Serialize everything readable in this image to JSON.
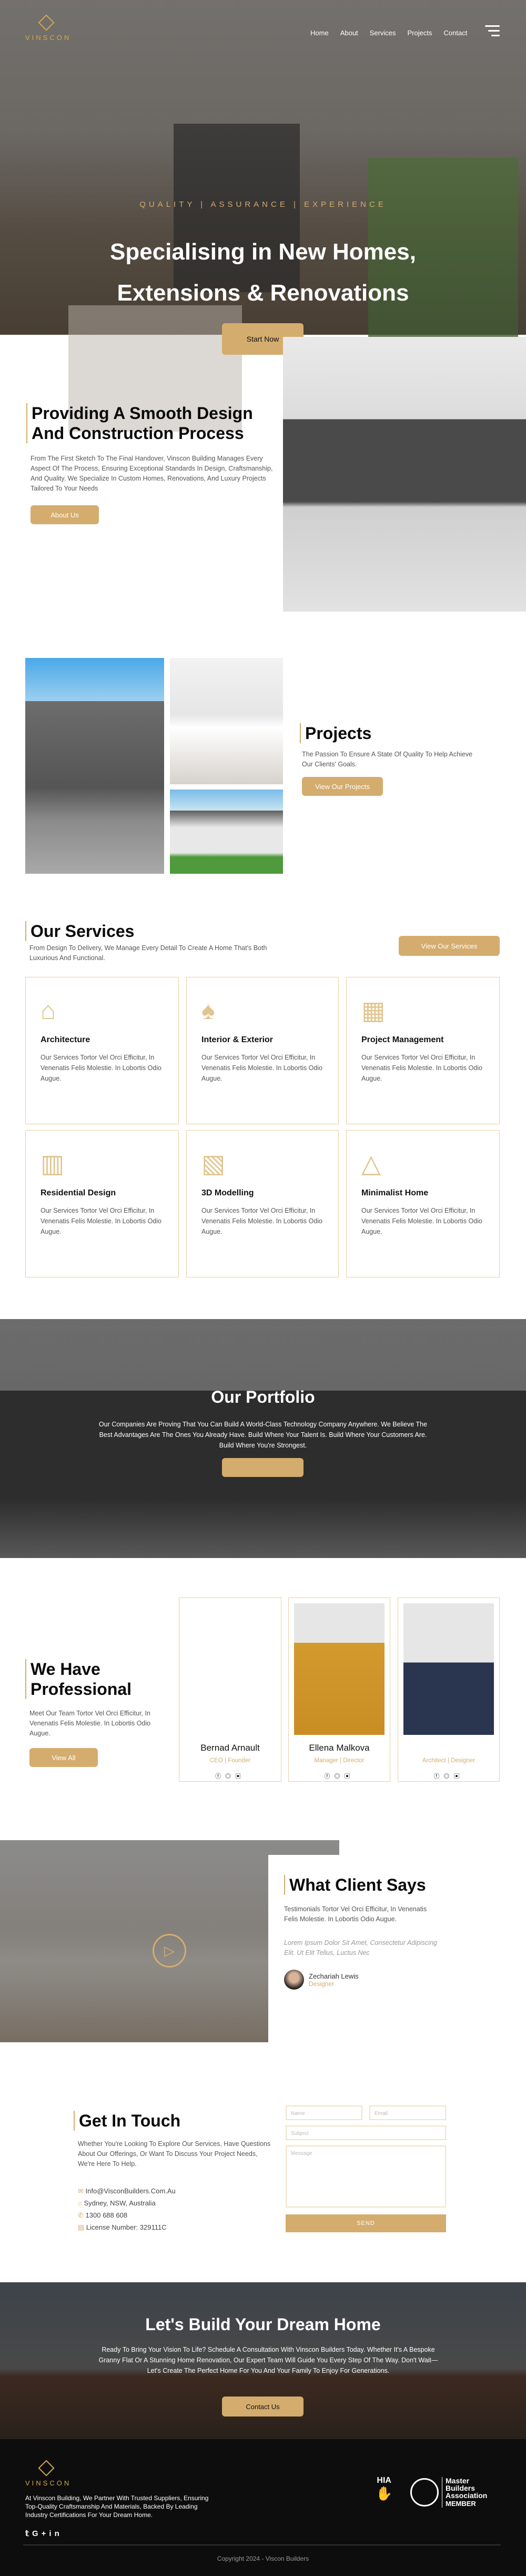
{
  "brand": {
    "name": "VINSCON"
  },
  "nav": {
    "items": [
      "Home",
      "About",
      "Services",
      "Projects",
      "Contact"
    ]
  },
  "hero": {
    "tagline": "QUALITY | ASSURANCE | EXPERIENCE",
    "title_line1": "Specialising in New Homes,",
    "title_line2": "Extensions & Renovations",
    "cta": "Start Now"
  },
  "about": {
    "title": "Providing A Smooth Design And Construction Process",
    "body": "From The First Sketch To The Final Handover, Vinscon Building Manages Every Aspect Of The Process, Ensuring Exceptional Standards In Design, Craftsmanship, And Quality. We Specialize In Custom Homes, Renovations, And Luxury Projects Tailored To Your Needs",
    "cta": "About Us"
  },
  "projects": {
    "title": "Projects",
    "body": "The Passion To Ensure A State Of Quality To Help Achieve Our Clients' Goals.",
    "cta": "View Our Projects"
  },
  "services": {
    "title": "Our Services",
    "body": "From Design To Delivery, We Manage Every Detail To Create A Home That's Both Luxurious And Functional.",
    "cta": "View Our Services",
    "items": [
      {
        "title": "Architecture",
        "body": "Our Services Tortor Vel Orci Efficitur, In Venenatis Felis Molestie. In Lobortis Odio Augue.",
        "icon": "house-outline-icon"
      },
      {
        "title": "Interior & Exterior",
        "body": "Our Services Tortor Vel Orci Efficitur, In Venenatis Felis Molestie. In Lobortis Odio Augue.",
        "icon": "trees-outline-icon"
      },
      {
        "title": "Project Management",
        "body": "Our Services Tortor Vel Orci Efficitur, In Venenatis Felis Molestie. In Lobortis Odio Augue.",
        "icon": "modern-building-icon"
      },
      {
        "title": "Residential Design",
        "body": "Our Services Tortor Vel Orci Efficitur, In Venenatis Felis Molestie. In Lobortis Odio Augue.",
        "icon": "residence-icon"
      },
      {
        "title": "3D Modelling",
        "body": "Our Services Tortor Vel Orci Efficitur, In Venenatis Felis Molestie. In Lobortis Odio Augue.",
        "icon": "3d-building-icon"
      },
      {
        "title": "Minimalist Home",
        "body": "Our Services Tortor Vel Orci Efficitur, In Venenatis Felis Molestie. In Lobortis Odio Augue.",
        "icon": "a-frame-house-icon"
      }
    ]
  },
  "portfolio": {
    "title": "Our Portfolio",
    "body": "Our Companies Are Proving That You Can Build A World-Class Technology Company Anywhere. We Believe The Best Advantages Are The Ones You Already Have. Build Where Your Talent Is. Build Where Your Customers Are. Build Where You're Strongest."
  },
  "team": {
    "title": "We Have Professional",
    "body": "Meet Our Team Tortor Vel Orci Efficitur, In Venenatis Felis Molestie. In Lobortis Odio Augue.",
    "cta": "View All",
    "members": [
      {
        "name": "Bernad Arnault",
        "role": "CEO | Founder"
      },
      {
        "name": "Ellena Malkova",
        "role": "Manager | Director"
      },
      {
        "name": "",
        "role": "Architect | Designer"
      }
    ]
  },
  "testimonial": {
    "title": "What Client Says",
    "body": "Testimonials Tortor Vel Orci Efficitur, In Venenatis Felis Molestie. In Lobortis Odio Augue.",
    "quote": "Lorem Ipsum Dolor Sit Amet, Consectetur Adipiscing Elit. Ut Elit Tellus, Luctus Nec",
    "author": "Zechariah Lewis",
    "author_role": "Designer"
  },
  "contact": {
    "title": "Get In Touch",
    "body": "Whether You're Looking To Explore Our Services, Have Questions About Our Offerings, Or Want To Discuss Your Project Needs, We're Here To Help.",
    "email": "Info@VisconBuilders.Com.Au",
    "address": "Sydney, NSW, Australia",
    "phone": "1300 688 608",
    "license": "License Number: 329111C",
    "form": {
      "name_placeholder": "Name",
      "email_placeholder": "Email",
      "subject_placeholder": "Subject",
      "message_placeholder": "Message",
      "send": "SEND"
    }
  },
  "cta": {
    "title": "Let's Build Your Dream Home",
    "body": "Ready To Bring Your Vision To Life? Schedule A Consultation With Vinscon Builders Today. Whether It's A Bespoke Granny Flat Or A Stunning Home Renovation, Our Expert Team Will Guide You Every Step Of The Way. Don't Wait—Let's Create The Perfect Home For You And Your Family To Enjoy For Generations.",
    "button": "Contact Us"
  },
  "footer": {
    "body": "At Vinscon Building, We Partner With Trusted Suppliers, Ensuring Top-Quality Craftsmanship And Materials, Backed By Leading Industry Certifications For Your Dream Home.",
    "hia": "HIA",
    "mba_line1": "Master",
    "mba_line2": "Builders",
    "mba_line3": "Association",
    "mba_member": "MEMBER",
    "copyright": "Copyright 2024 - Viscon Builders"
  },
  "colors": {
    "gold": "#d4ac6e",
    "dark": "#0d0d0d"
  }
}
